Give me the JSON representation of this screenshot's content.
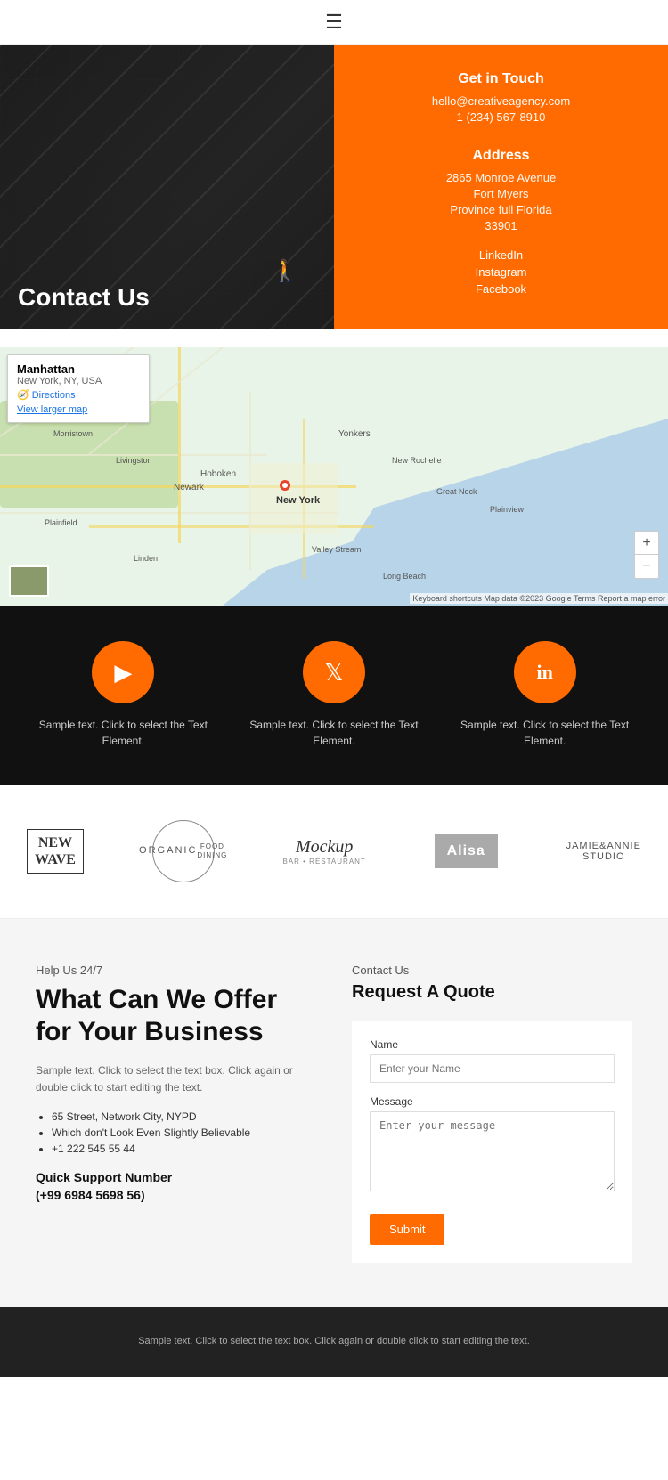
{
  "header": {
    "menu_icon": "☰"
  },
  "hero": {
    "title": "Contact Us",
    "contact_title": "Get in Touch",
    "email": "hello@creativeagency.com",
    "phone": "1 (234) 567-8910",
    "address_title": "Address",
    "address_line1": "2865 Monroe Avenue",
    "address_line2": "Fort Myers",
    "address_line3": "Province full Florida",
    "address_line4": "33901",
    "social_linkedin": "LinkedIn",
    "social_instagram": "Instagram",
    "social_facebook": "Facebook"
  },
  "map": {
    "location_title": "Manhattan",
    "location_subtitle": "New York, NY, USA",
    "directions_label": "Directions",
    "view_larger": "View larger map",
    "zoom_in": "+",
    "zoom_out": "−",
    "attribution": "Keyboard shortcuts  Map data ©2023 Google  Terms  Report a map error"
  },
  "social_section": {
    "items": [
      {
        "icon": "▶",
        "icon_name": "youtube-icon",
        "text": "Sample text. Click to select the Text Element."
      },
      {
        "icon": "🐦",
        "icon_name": "twitter-icon",
        "text": "Sample text. Click to select the Text Element."
      },
      {
        "icon": "in",
        "icon_name": "linkedin-icon",
        "text": "Sample text. Click to select the Text Element."
      }
    ]
  },
  "partners": {
    "logos": [
      {
        "name": "New Wave",
        "display": "NEW\nWAVE",
        "type": "box"
      },
      {
        "name": "Organic",
        "display": "ORGANIC\nFOOD DINING",
        "type": "circle"
      },
      {
        "name": "Mockup",
        "display": "Mockup",
        "type": "script",
        "sub": "BAR • RESTAURANT"
      },
      {
        "name": "Alisa",
        "display": "Alisa",
        "type": "badge"
      },
      {
        "name": "Jamie & Annie",
        "display": "JAMIE&ANNIE\nSTUDIO",
        "type": "text"
      }
    ]
  },
  "contact": {
    "help_label": "Help Us 24/7",
    "main_title": "What Can We Offer for Your Business",
    "description": "Sample text. Click to select the text box. Click again or double click to start editing the text.",
    "list_items": [
      "65 Street, Network City, NYPD",
      "Which don't Look Even Slightly Believable",
      "+1 222 545 55 44"
    ],
    "support_label": "Quick Support Number",
    "support_number": "(+99 6984 5698 56)",
    "right_label": "Contact Us",
    "right_title": "Request A Quote",
    "form": {
      "name_label": "Name",
      "name_placeholder": "Enter your Name",
      "message_label": "Message",
      "message_placeholder": "Enter your message",
      "submit_label": "Submit"
    }
  },
  "footer": {
    "text": "Sample text. Click to select the text box. Click again or double click to start editing the text."
  }
}
